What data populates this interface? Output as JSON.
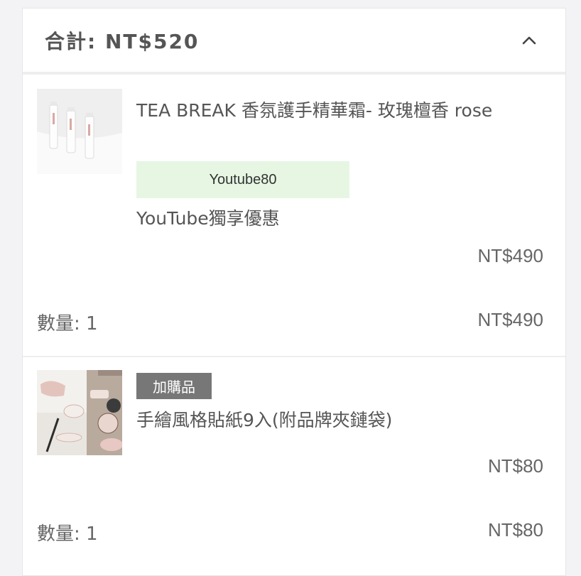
{
  "summary": {
    "total_label": "合計: NT$520",
    "toggle_icon": "chevron-up-icon"
  },
  "items": [
    {
      "name": "TEA BREAK 香氛護手精華霜- 玫瑰檀香 rose",
      "promo_code": "Youtube80",
      "promo_desc": "YouTube獨享優惠",
      "unit_price": "NT$490",
      "quantity": "數量: 1",
      "line_total": "NT$490"
    },
    {
      "badge": "加購品",
      "name": "手繪風格貼紙9入(附品牌夾鏈袋)",
      "unit_price": "NT$80",
      "quantity": "數量: 1",
      "line_total": "NT$80"
    }
  ],
  "colors": {
    "promo_bg": "#e6f6e3",
    "badge_bg": "#777777"
  }
}
